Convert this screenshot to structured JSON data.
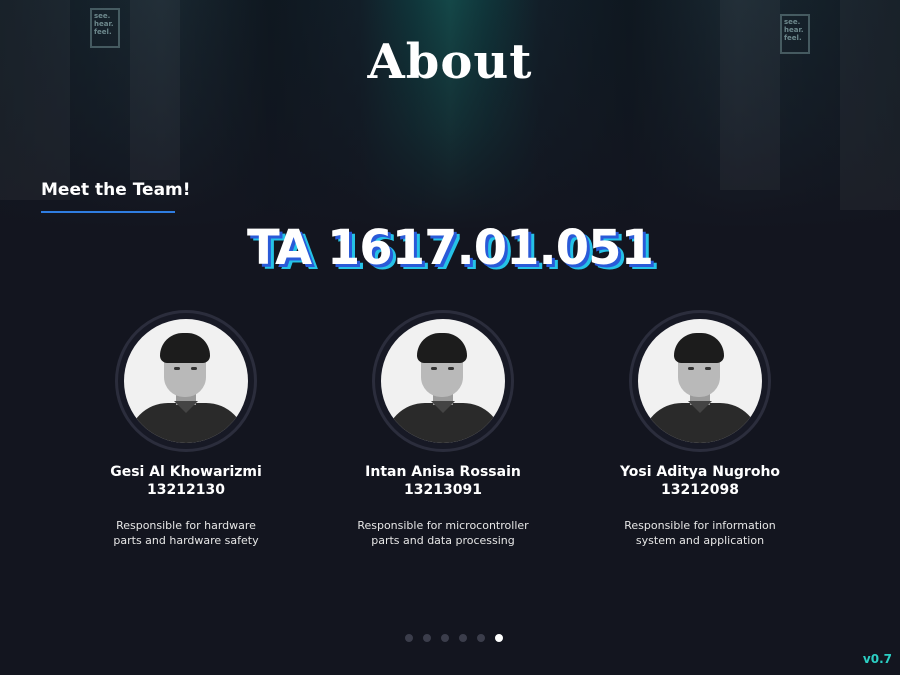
{
  "hero": {
    "title": "About"
  },
  "section": {
    "heading": "Meet the Team!"
  },
  "project": {
    "code": "TA 1617.01.051"
  },
  "team": [
    {
      "name": "Gesi Al Khowarizmi",
      "nim": "13212130",
      "desc1": "Responsible for hardware",
      "desc2": "parts and hardware safety"
    },
    {
      "name": "Intan Anisa Rossain",
      "nim": "13213091",
      "desc1": "Responsible for microcontroller",
      "desc2": "parts and data processing"
    },
    {
      "name": "Yosi Aditya Nugroho",
      "nim": "13212098",
      "desc1": "Responsible for information",
      "desc2": "system and application"
    }
  ],
  "signs": {
    "left": "see. hear. feel.",
    "right": "see. hear. feel."
  },
  "pagination": {
    "total": 6,
    "active_index": 5
  },
  "version": "v0.7",
  "colors": {
    "background": "#13151f",
    "accent_blue": "#2f7de1",
    "accent_cyan": "#25c2e6",
    "version_teal": "#2ccfc4"
  }
}
